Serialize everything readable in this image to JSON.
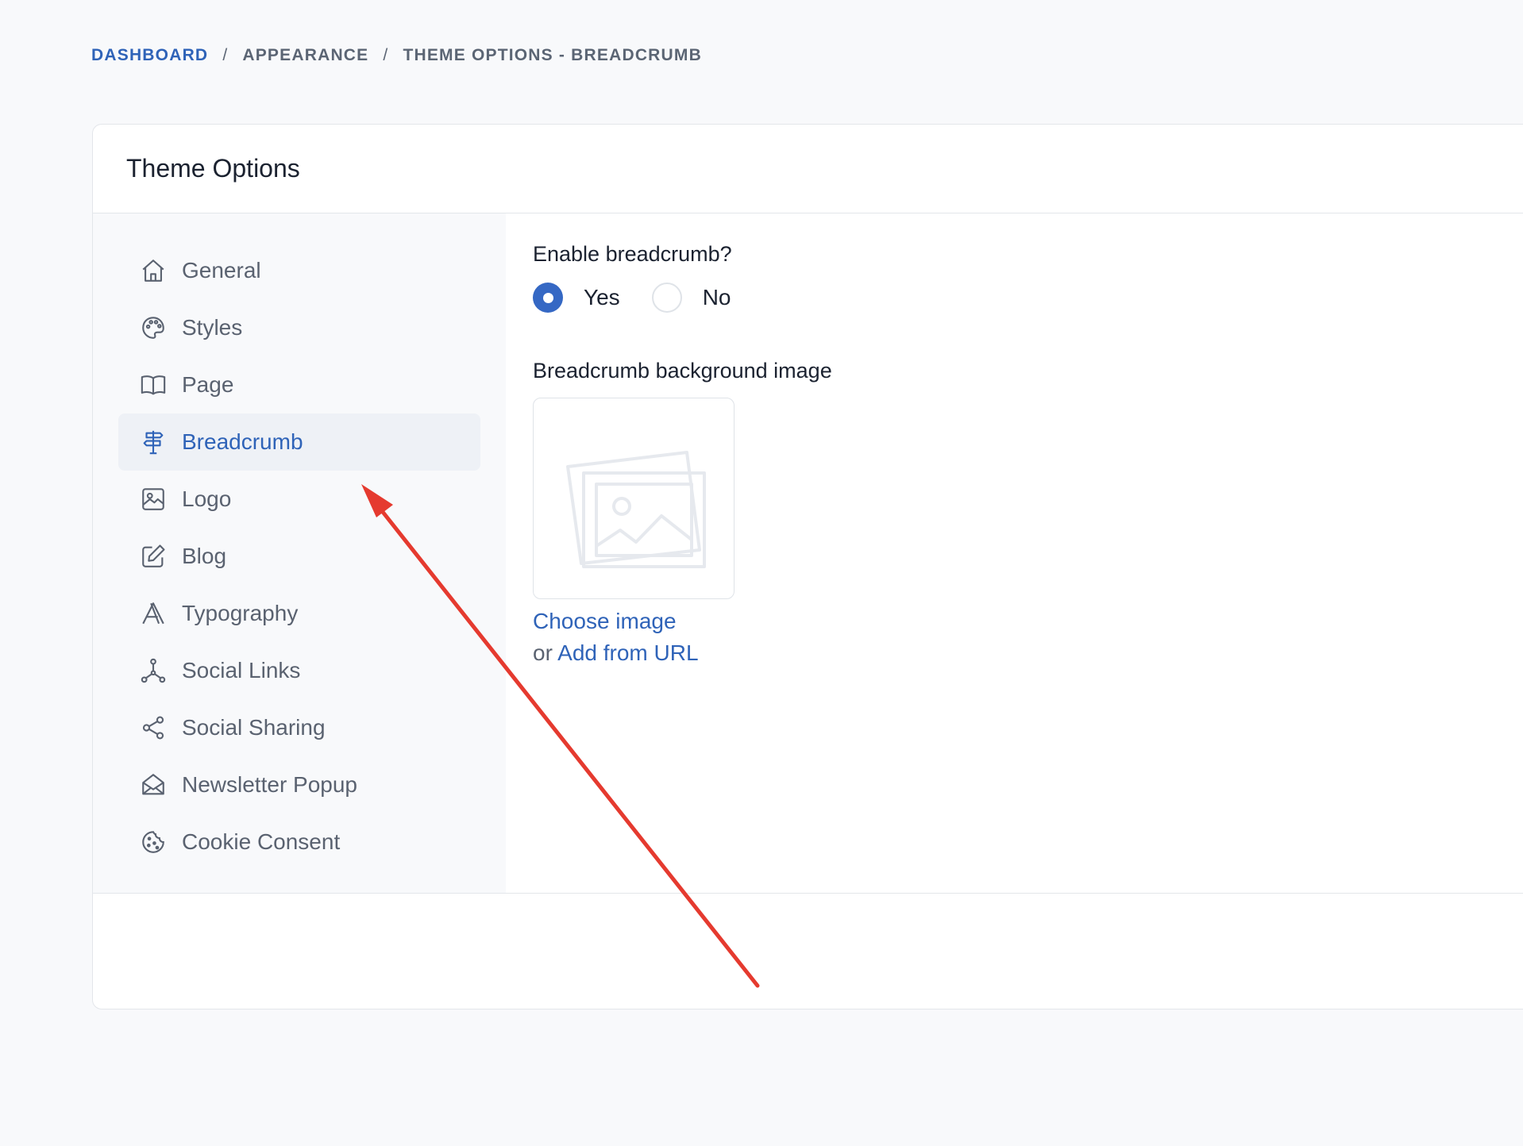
{
  "breadcrumb": {
    "items": [
      "DASHBOARD",
      "APPEARANCE",
      "THEME OPTIONS - BREADCRUMB"
    ],
    "separator": "/"
  },
  "card": {
    "title": "Theme Options"
  },
  "sidebar": {
    "items": [
      {
        "label": "General",
        "icon": "home-icon"
      },
      {
        "label": "Styles",
        "icon": "palette-icon"
      },
      {
        "label": "Page",
        "icon": "book-icon"
      },
      {
        "label": "Breadcrumb",
        "icon": "signpost-icon",
        "active": true
      },
      {
        "label": "Logo",
        "icon": "image-icon"
      },
      {
        "label": "Blog",
        "icon": "edit-icon"
      },
      {
        "label": "Typography",
        "icon": "typography-icon"
      },
      {
        "label": "Social Links",
        "icon": "network-icon"
      },
      {
        "label": "Social Sharing",
        "icon": "share-icon"
      },
      {
        "label": "Newsletter Popup",
        "icon": "mail-open-icon"
      },
      {
        "label": "Cookie Consent",
        "icon": "cookie-icon"
      }
    ]
  },
  "form": {
    "enable_label": "Enable breadcrumb?",
    "options": [
      {
        "label": "Yes",
        "checked": true
      },
      {
        "label": "No",
        "checked": false
      }
    ],
    "bg_label": "Breadcrumb background image",
    "choose_image": "Choose image",
    "or_text": "or",
    "add_from_url": "Add from URL"
  },
  "colors": {
    "accent": "#2f63b8",
    "annotation_arrow": "#e53a2f"
  }
}
